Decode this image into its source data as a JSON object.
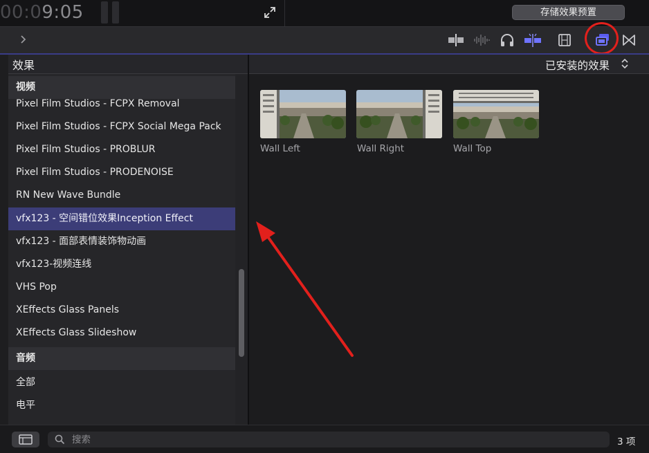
{
  "viewer": {
    "timecode_dim": "00:0",
    "timecode_main": "9:05",
    "save_preset_label": "存储效果预置"
  },
  "toolbar": {
    "expand_icon": "chevron-right-icon",
    "icons": [
      "clip-split-icon",
      "audio-waveform-icon",
      "headphones-icon",
      "snapping-icon",
      "film-strip-icon",
      "effects-browser-icon",
      "transitions-browser-icon"
    ],
    "active_icon": "effects-browser-icon",
    "accent_color": "#5a5cf0"
  },
  "sidebar": {
    "title": "效果",
    "sections": [
      {
        "header": "视频",
        "items": [
          "Pixel Film Studios - FCPX Removal",
          "Pixel Film Studios - FCPX Social Mega Pack",
          "Pixel Film Studios - PROBLUR",
          "Pixel Film Studios - PRODENOISE",
          "RN New Wave Bundle",
          "vfx123 - 空间错位效果Inception Effect",
          "vfx123 - 面部表情装饰物动画",
          "vfx123-视频连线",
          "VHS Pop",
          "XEffects Glass Panels",
          "XEffects Glass Slideshow"
        ],
        "selected": "vfx123 - 空间错位效果Inception Effect"
      },
      {
        "header": "音频",
        "items": [
          "全部",
          "电平"
        ]
      }
    ]
  },
  "browser": {
    "filter_label": "已安装的效果",
    "effects": [
      {
        "name": "Wall Left"
      },
      {
        "name": "Wall Right"
      },
      {
        "name": "Wall Top"
      }
    ]
  },
  "footer": {
    "search_placeholder": "搜索",
    "item_count": "3 项"
  },
  "annotations": {
    "highlight_color": "#e2201c"
  }
}
